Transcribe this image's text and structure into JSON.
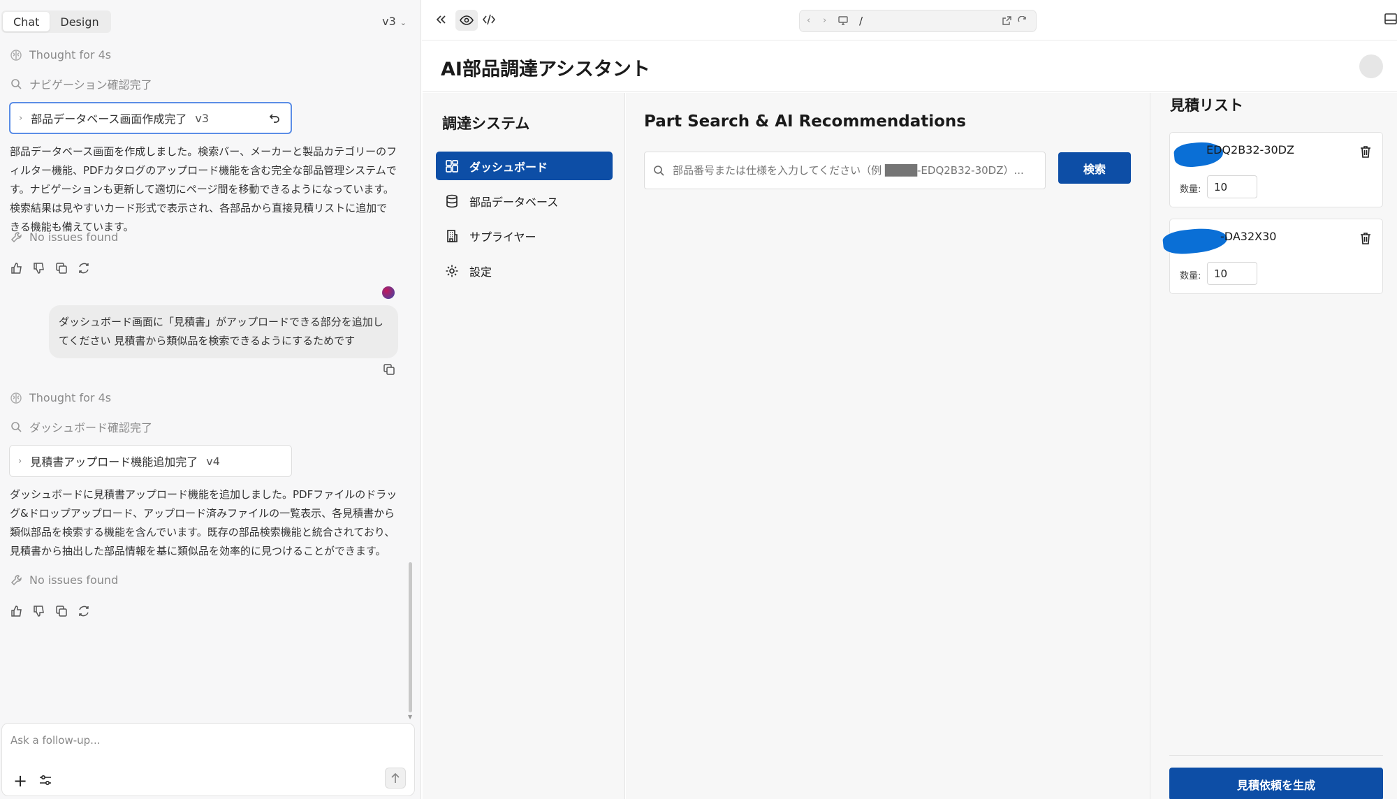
{
  "chat": {
    "tabs": [
      {
        "label": "Chat",
        "active": true
      },
      {
        "label": "Design",
        "active": false
      }
    ],
    "version_selector": "v3",
    "messages": [
      {
        "thought": "Thought for 4s",
        "status": "ナビゲーション確認完了",
        "version_card": {
          "label": "部品データベース画面作成完了",
          "version": "v3"
        },
        "text": "部品データベース画面を作成しました。検索バー、メーカーと製品カテゴリーのフィルター機能、PDFカタログのアップロード機能を含む完全な部品管理システムです。ナビゲーションも更新して適切にページ間を移動できるようになっています。検索結果は見やすいカード形式で表示され、各部品から直接見積リストに追加できる機能も備えています。",
        "issues": "No issues found"
      },
      {
        "user": "ダッシュボード画面に「見積書」がアップロードできる部分を追加してください 見積書から類似品を検索できるようにするためです"
      },
      {
        "thought": "Thought for 4s",
        "status": "ダッシュボード確認完了",
        "version_card": {
          "label": "見積書アップロード機能追加完了",
          "version": "v4"
        },
        "text": "ダッシュボードに見積書アップロード機能を追加しました。PDFファイルのドラッグ&ドロップアップロード、アップロード済みファイルの一覧表示、各見積書から類似部品を検索する機能を含んでいます。既存の部品検索機能と統合されており、見積書から抽出した部品情報を基に類似品を効率的に見つけることができます。",
        "issues": "No issues found"
      }
    ],
    "composer_placeholder": "Ask a follow-up..."
  },
  "preview": {
    "url_path": "/"
  },
  "app": {
    "title": "AI部品調達アシスタント",
    "sidebar": {
      "title": "調達システム",
      "items": [
        {
          "label": "ダッシュボード",
          "icon": "grid-icon",
          "active": true
        },
        {
          "label": "部品データベース",
          "icon": "database-icon",
          "active": false
        },
        {
          "label": "サプライヤー",
          "icon": "building-icon",
          "active": false
        },
        {
          "label": "設定",
          "icon": "gear-icon",
          "active": false
        }
      ]
    },
    "main": {
      "section_title": "Part Search & AI Recommendations",
      "search_placeholder": "部品番号または仕様を入力してください（例 ████-EDQ2B32-30DZ）...",
      "search_button": "検索"
    },
    "quote_list": {
      "title": "見積リスト",
      "items": [
        {
          "part_no": "EDQ2B32-30DZ",
          "qty_label": "数量:",
          "qty": "10"
        },
        {
          "part_no": "-DA32X30",
          "qty_label": "数量:",
          "qty": "10"
        }
      ],
      "generate_button": "見積依頼を生成"
    }
  },
  "colors": {
    "primary": "#0d4ea6",
    "redaction": "#0a6fd6"
  }
}
